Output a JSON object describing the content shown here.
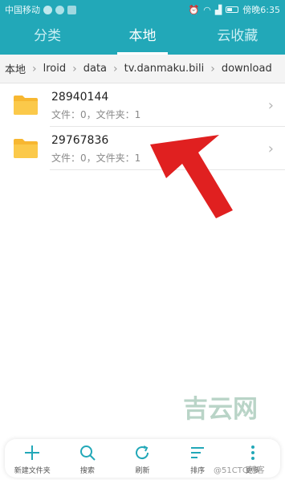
{
  "status_bar": {
    "carrier": "中国移动",
    "time": "傍晚6:35"
  },
  "tabs": [
    {
      "label": "分类",
      "active": false
    },
    {
      "label": "本地",
      "active": true
    },
    {
      "label": "云收藏",
      "active": false
    }
  ],
  "breadcrumb": [
    "本地",
    "lroid",
    "data",
    "tv.danmaku.bili",
    "download"
  ],
  "files": [
    {
      "name": "28940144",
      "meta": "文件：0，文件夹：1"
    },
    {
      "name": "29767836",
      "meta": "文件：0，文件夹：1"
    }
  ],
  "toolbar": [
    {
      "label": "新建文件夹",
      "icon": "plus-icon"
    },
    {
      "label": "搜索",
      "icon": "search-icon"
    },
    {
      "label": "刷新",
      "icon": "refresh-icon"
    },
    {
      "label": "排序",
      "icon": "sort-icon"
    },
    {
      "label": "更多",
      "icon": "more-icon"
    }
  ],
  "watermark": {
    "logo_text": "吉云网",
    "label": "@51CTO博客"
  },
  "colors": {
    "header": "#22a8b8",
    "folder": "#f7b731",
    "arrow": "#e02020",
    "watermark": "#b9d4c7"
  }
}
